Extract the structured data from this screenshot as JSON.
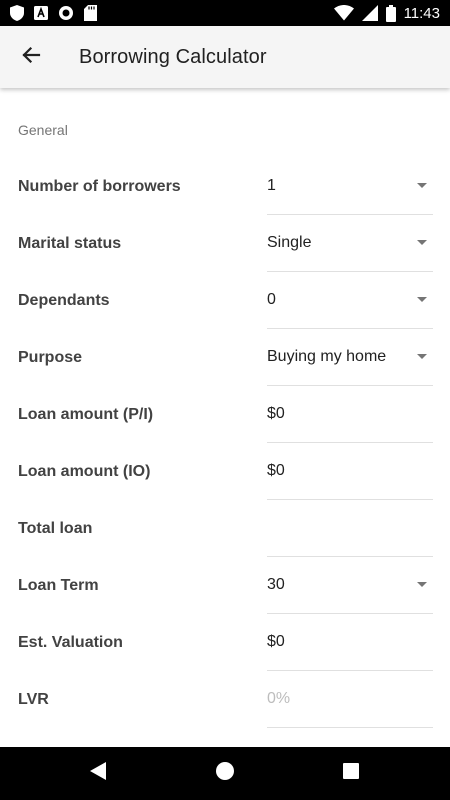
{
  "status_bar": {
    "time": "11:43",
    "icons": [
      "shield-icon",
      "font-a-icon",
      "circle-icon",
      "sd-card-icon",
      "wifi-icon",
      "signal-icon",
      "battery-icon"
    ]
  },
  "app_bar": {
    "title": "Borrowing Calculator",
    "back_icon": "arrow-left-icon"
  },
  "form": {
    "section_title": "General",
    "fields": [
      {
        "label": "Number of borrowers",
        "value": "1",
        "type": "dropdown"
      },
      {
        "label": "Marital status",
        "value": "Single",
        "type": "dropdown"
      },
      {
        "label": "Dependants",
        "value": "0",
        "type": "dropdown"
      },
      {
        "label": "Purpose",
        "value": "Buying my home",
        "type": "dropdown"
      },
      {
        "label": "Loan amount (P/I)",
        "value": "$0",
        "type": "input"
      },
      {
        "label": "Loan amount (IO)",
        "value": "$0",
        "type": "input"
      },
      {
        "label": "Total loan",
        "value": "",
        "type": "readonly"
      },
      {
        "label": "Loan Term",
        "value": "30",
        "type": "dropdown"
      },
      {
        "label": "Est. Valuation",
        "value": "$0",
        "type": "input"
      },
      {
        "label": "LVR",
        "value": "0%",
        "type": "readonly-placeholder"
      }
    ]
  },
  "nav_bar": {
    "buttons": [
      "back-triangle-icon",
      "home-circle-icon",
      "recents-square-icon"
    ]
  },
  "colors": {
    "status_bar_bg": "#000000",
    "app_bar_bg": "#f5f5f5",
    "nav_bar_bg": "#000000",
    "label_text": "#424242",
    "value_text": "#212121",
    "section_text": "#757575",
    "divider": "#e0e0e0",
    "placeholder_text": "#bdbdbd"
  }
}
